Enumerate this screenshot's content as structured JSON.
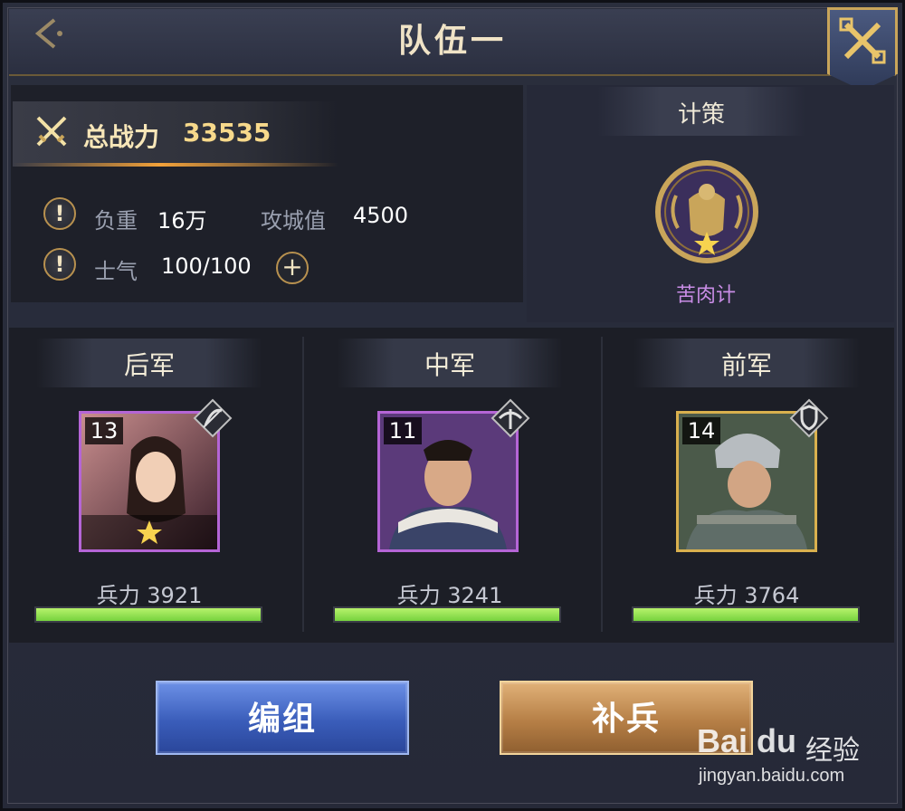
{
  "header": {
    "title": "队伍一"
  },
  "power": {
    "label": "总战力",
    "value": "33535"
  },
  "stats": {
    "load_label": "负重",
    "load_value": "16万",
    "siege_label": "攻城值",
    "siege_value": "4500",
    "morale_label": "士气",
    "morale_value": "100/100",
    "add_label": "+",
    "info_glyph": "!"
  },
  "strategy": {
    "title": "计策",
    "name": "苦肉计"
  },
  "armies": [
    {
      "title": "后军",
      "level": "13",
      "troops": "兵力 3921",
      "troop_ratio": 1.0,
      "type": "bow",
      "frame": "purple"
    },
    {
      "title": "中军",
      "level": "11",
      "troops": "兵力 3241",
      "troop_ratio": 1.0,
      "type": "crossbow",
      "frame": "purple"
    },
    {
      "title": "前军",
      "level": "14",
      "troops": "兵力 3764",
      "troop_ratio": 1.0,
      "type": "shield",
      "frame": "gold"
    }
  ],
  "buttons": {
    "formation": "编组",
    "reinforce": "补兵"
  },
  "watermark": {
    "logo": "Bai du",
    "sub": "经验",
    "url": "jingyan.baidu.com"
  },
  "colors": {
    "accent_gold": "#d9b04e",
    "hp_green": "#8fe04f",
    "strategy_purple": "#c98de6"
  }
}
